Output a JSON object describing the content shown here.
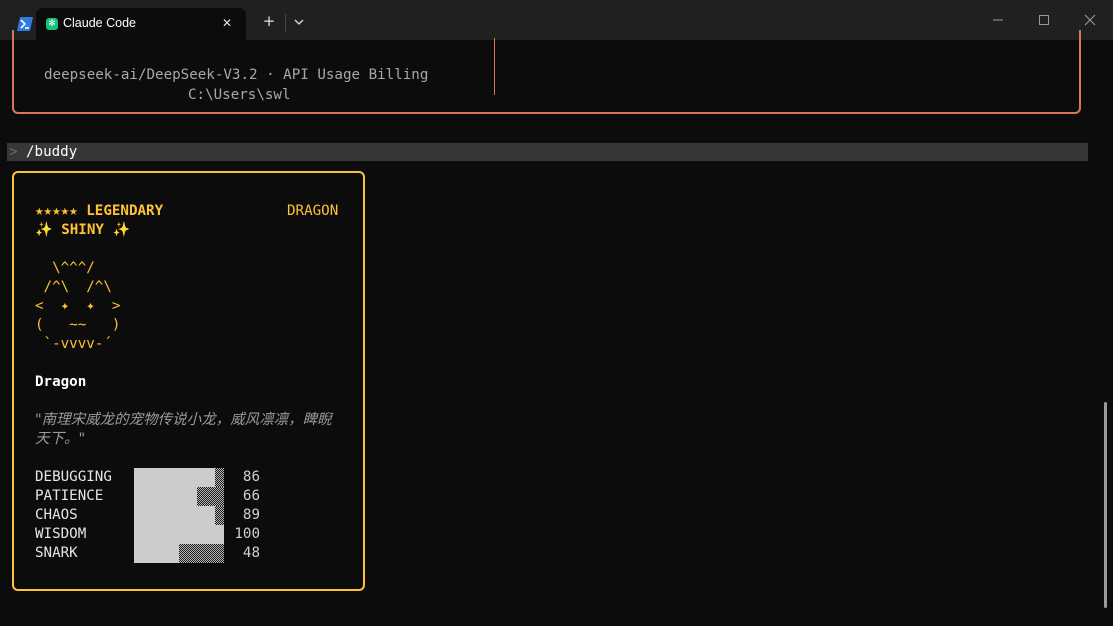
{
  "window": {
    "tab_title": "Claude Code",
    "tab_icon": "claude-code-icon",
    "shell_icon": "powershell-icon",
    "new_tab_symbol": "+",
    "close_tab_symbol": "✕"
  },
  "welcome": {
    "model_line": "deepseek-ai/DeepSeek-V3.2 · API Usage Billing",
    "cwd_line": "C:\\Users\\swl"
  },
  "prompt": {
    "symbol": ">",
    "command": "/buddy"
  },
  "buddy": {
    "rarity": "★★★★★ LEGENDARY",
    "species": "DRAGON",
    "shiny": "✨ SHINY ✨",
    "ascii_art": "  \\^^^/\n /^\\  /^\\\n<  ✦  ✦  >\n(   ~~   )\n `-vvvv-´",
    "name": "Dragon",
    "quote": "\"南理宋威龙的宠物传说小龙，威风凛凛，睥睨天下。\"",
    "stats": [
      {
        "label": "DEBUGGING",
        "value": 86
      },
      {
        "label": "PATIENCE",
        "value": 66
      },
      {
        "label": "CHAOS",
        "value": 89
      },
      {
        "label": "WISDOM",
        "value": 100
      },
      {
        "label": "SNARK",
        "value": 48
      }
    ],
    "stat_max": 100
  },
  "colors": {
    "accent_orange": "#d77757",
    "legendary_gold": "#ffc233",
    "background": "#0c0c0c"
  }
}
